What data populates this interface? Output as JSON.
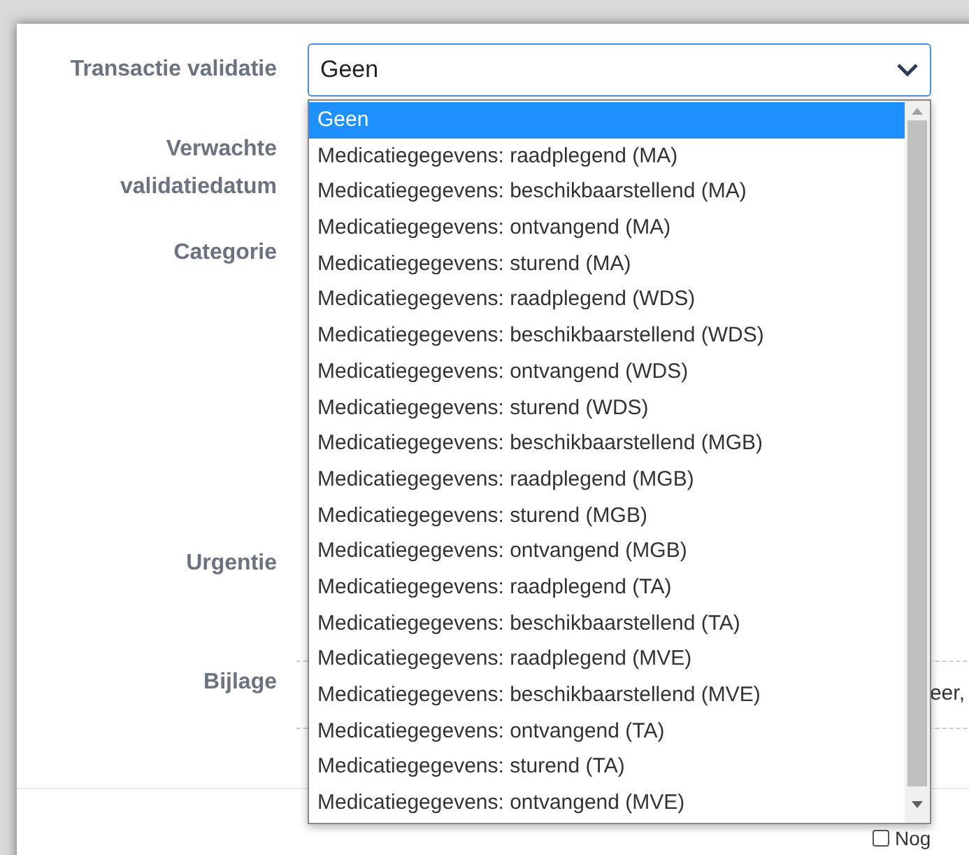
{
  "form": {
    "fields": [
      {
        "label": "Transactie validatie",
        "kind": "select"
      },
      {
        "label": "Verwachte validatiedatum",
        "kind": "blank"
      },
      {
        "label": "Categorie",
        "kind": "blank"
      },
      {
        "label": "Urgentie",
        "kind": "blank"
      },
      {
        "label": "Bijlage",
        "kind": "attachment",
        "text": "eer,"
      }
    ]
  },
  "select": {
    "value": "Geen",
    "expanded": true,
    "options": [
      {
        "label": "Geen",
        "selected": true
      },
      {
        "label": "Medicatiegegevens: raadplegend (MA)",
        "selected": false
      },
      {
        "label": "Medicatiegegevens: beschikbaarstellend (MA)",
        "selected": false
      },
      {
        "label": "Medicatiegegevens: ontvangend (MA)",
        "selected": false
      },
      {
        "label": "Medicatiegegevens: sturend (MA)",
        "selected": false
      },
      {
        "label": "Medicatiegegevens: raadplegend (WDS)",
        "selected": false
      },
      {
        "label": "Medicatiegegevens: beschikbaarstellend (WDS)",
        "selected": false
      },
      {
        "label": "Medicatiegegevens: ontvangend (WDS)",
        "selected": false
      },
      {
        "label": "Medicatiegegevens: sturend (WDS)",
        "selected": false
      },
      {
        "label": "Medicatiegegevens: beschikbaarstellend (MGB)",
        "selected": false
      },
      {
        "label": "Medicatiegegevens: raadplegend (MGB)",
        "selected": false
      },
      {
        "label": "Medicatiegegevens: sturend (MGB)",
        "selected": false
      },
      {
        "label": "Medicatiegegevens: ontvangend (MGB)",
        "selected": false
      },
      {
        "label": "Medicatiegegevens: raadplegend (TA)",
        "selected": false
      },
      {
        "label": "Medicatiegegevens: beschikbaarstellend (TA)",
        "selected": false
      },
      {
        "label": "Medicatiegegevens: raadplegend (MVE)",
        "selected": false
      },
      {
        "label": "Medicatiegegevens: beschikbaarstellend (MVE)",
        "selected": false
      },
      {
        "label": "Medicatiegegevens: ontvangend (TA)",
        "selected": false
      },
      {
        "label": "Medicatiegegevens: sturend (TA)",
        "selected": false
      },
      {
        "label": "Medicatiegegevens: ontvangend (MVE)",
        "selected": false
      }
    ]
  },
  "footer": {
    "checkbox": {
      "label": "Nog",
      "checked": false
    }
  }
}
